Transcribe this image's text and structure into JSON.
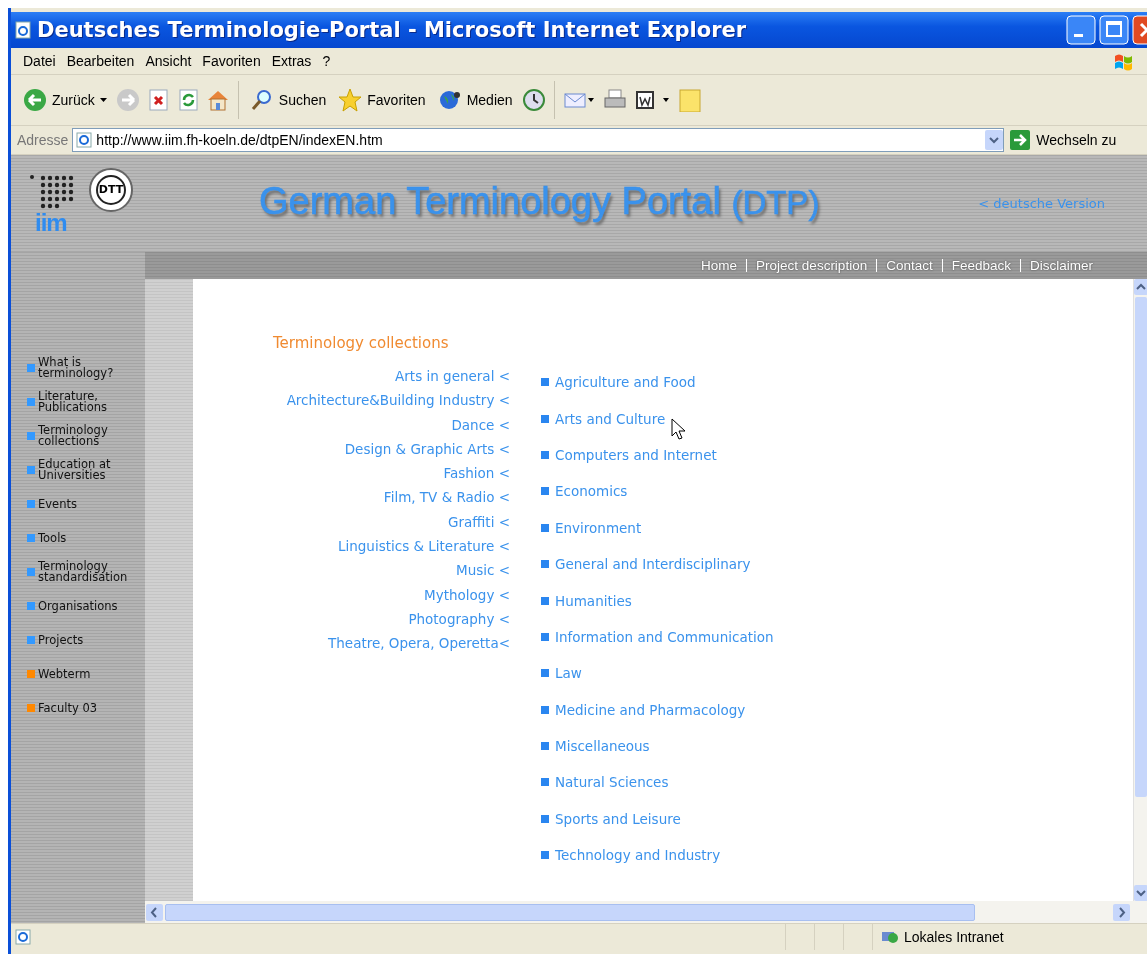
{
  "window": {
    "title": "Deutsches Terminologie-Portal - Microsoft Internet Explorer"
  },
  "menu": [
    "Datei",
    "Bearbeiten",
    "Ansicht",
    "Favoriten",
    "Extras",
    "?"
  ],
  "toolbar": [
    {
      "kind": "back",
      "label": "Zurück"
    },
    {
      "kind": "forward"
    },
    {
      "kind": "stop"
    },
    {
      "kind": "refresh"
    },
    {
      "kind": "home"
    },
    {
      "kind": "search",
      "label": "Suchen"
    },
    {
      "kind": "favorites",
      "label": "Favoriten"
    },
    {
      "kind": "media",
      "label": "Medien"
    },
    {
      "kind": "history"
    },
    {
      "kind": "mail"
    },
    {
      "kind": "print"
    },
    {
      "kind": "edit"
    },
    {
      "kind": "note"
    }
  ],
  "address": {
    "label": "Adresse",
    "value": "http://www.iim.fh-koeln.de/dtpEN/indexEN.htm",
    "go_label": "Wechseln zu"
  },
  "page": {
    "logo": "iim",
    "seal": "DTT",
    "title": "German Terminology Portal",
    "acronym": "(DTP)",
    "language_link": "< deutsche Version",
    "nav": [
      "Home",
      "Project description",
      "Contact",
      "Feedback",
      "Disclaimer"
    ],
    "sidebar": [
      {
        "label": "What is terminology?",
        "color": "#3399ff"
      },
      {
        "label": "Literature, Publications",
        "color": "#3399ff"
      },
      {
        "label": "Terminology collections",
        "color": "#3399ff"
      },
      {
        "label": "Education at Universities",
        "color": "#3399ff"
      },
      {
        "label": "Events",
        "color": "#3399ff"
      },
      {
        "label": "Tools",
        "color": "#3399ff"
      },
      {
        "label": "Terminology standardisation",
        "color": "#3399ff"
      },
      {
        "label": "Organisations",
        "color": "#3399ff"
      },
      {
        "label": "Projects",
        "color": "#3399ff"
      },
      {
        "label": "Webterm",
        "color": "#ff8800"
      },
      {
        "label": "Faculty 03",
        "color": "#ff8800"
      }
    ],
    "heading": "Terminology collections",
    "collections": [
      "Arts in general <",
      "Architecture&Building Industry <",
      "Dance <",
      "Design & Graphic Arts <",
      "Fashion <",
      "Film, TV & Radio <",
      "Graffiti <",
      "Linguistics & Literature <",
      "Music <",
      "Mythology <",
      "Photography <",
      "Theatre, Opera, Operetta<"
    ],
    "subjects": [
      "Agriculture and Food",
      "Arts and Culture",
      "Computers and Internet",
      "Economics",
      "Environment",
      "General and Interdisciplinary",
      "Humanities",
      "Information and Communication",
      "Law",
      "Medicine and Pharmacology",
      "Miscellaneous",
      "Natural Sciences",
      "Sports and Leisure",
      "Technology and Industry"
    ]
  },
  "status_bar": {
    "zone": "Lokales Intranet"
  }
}
